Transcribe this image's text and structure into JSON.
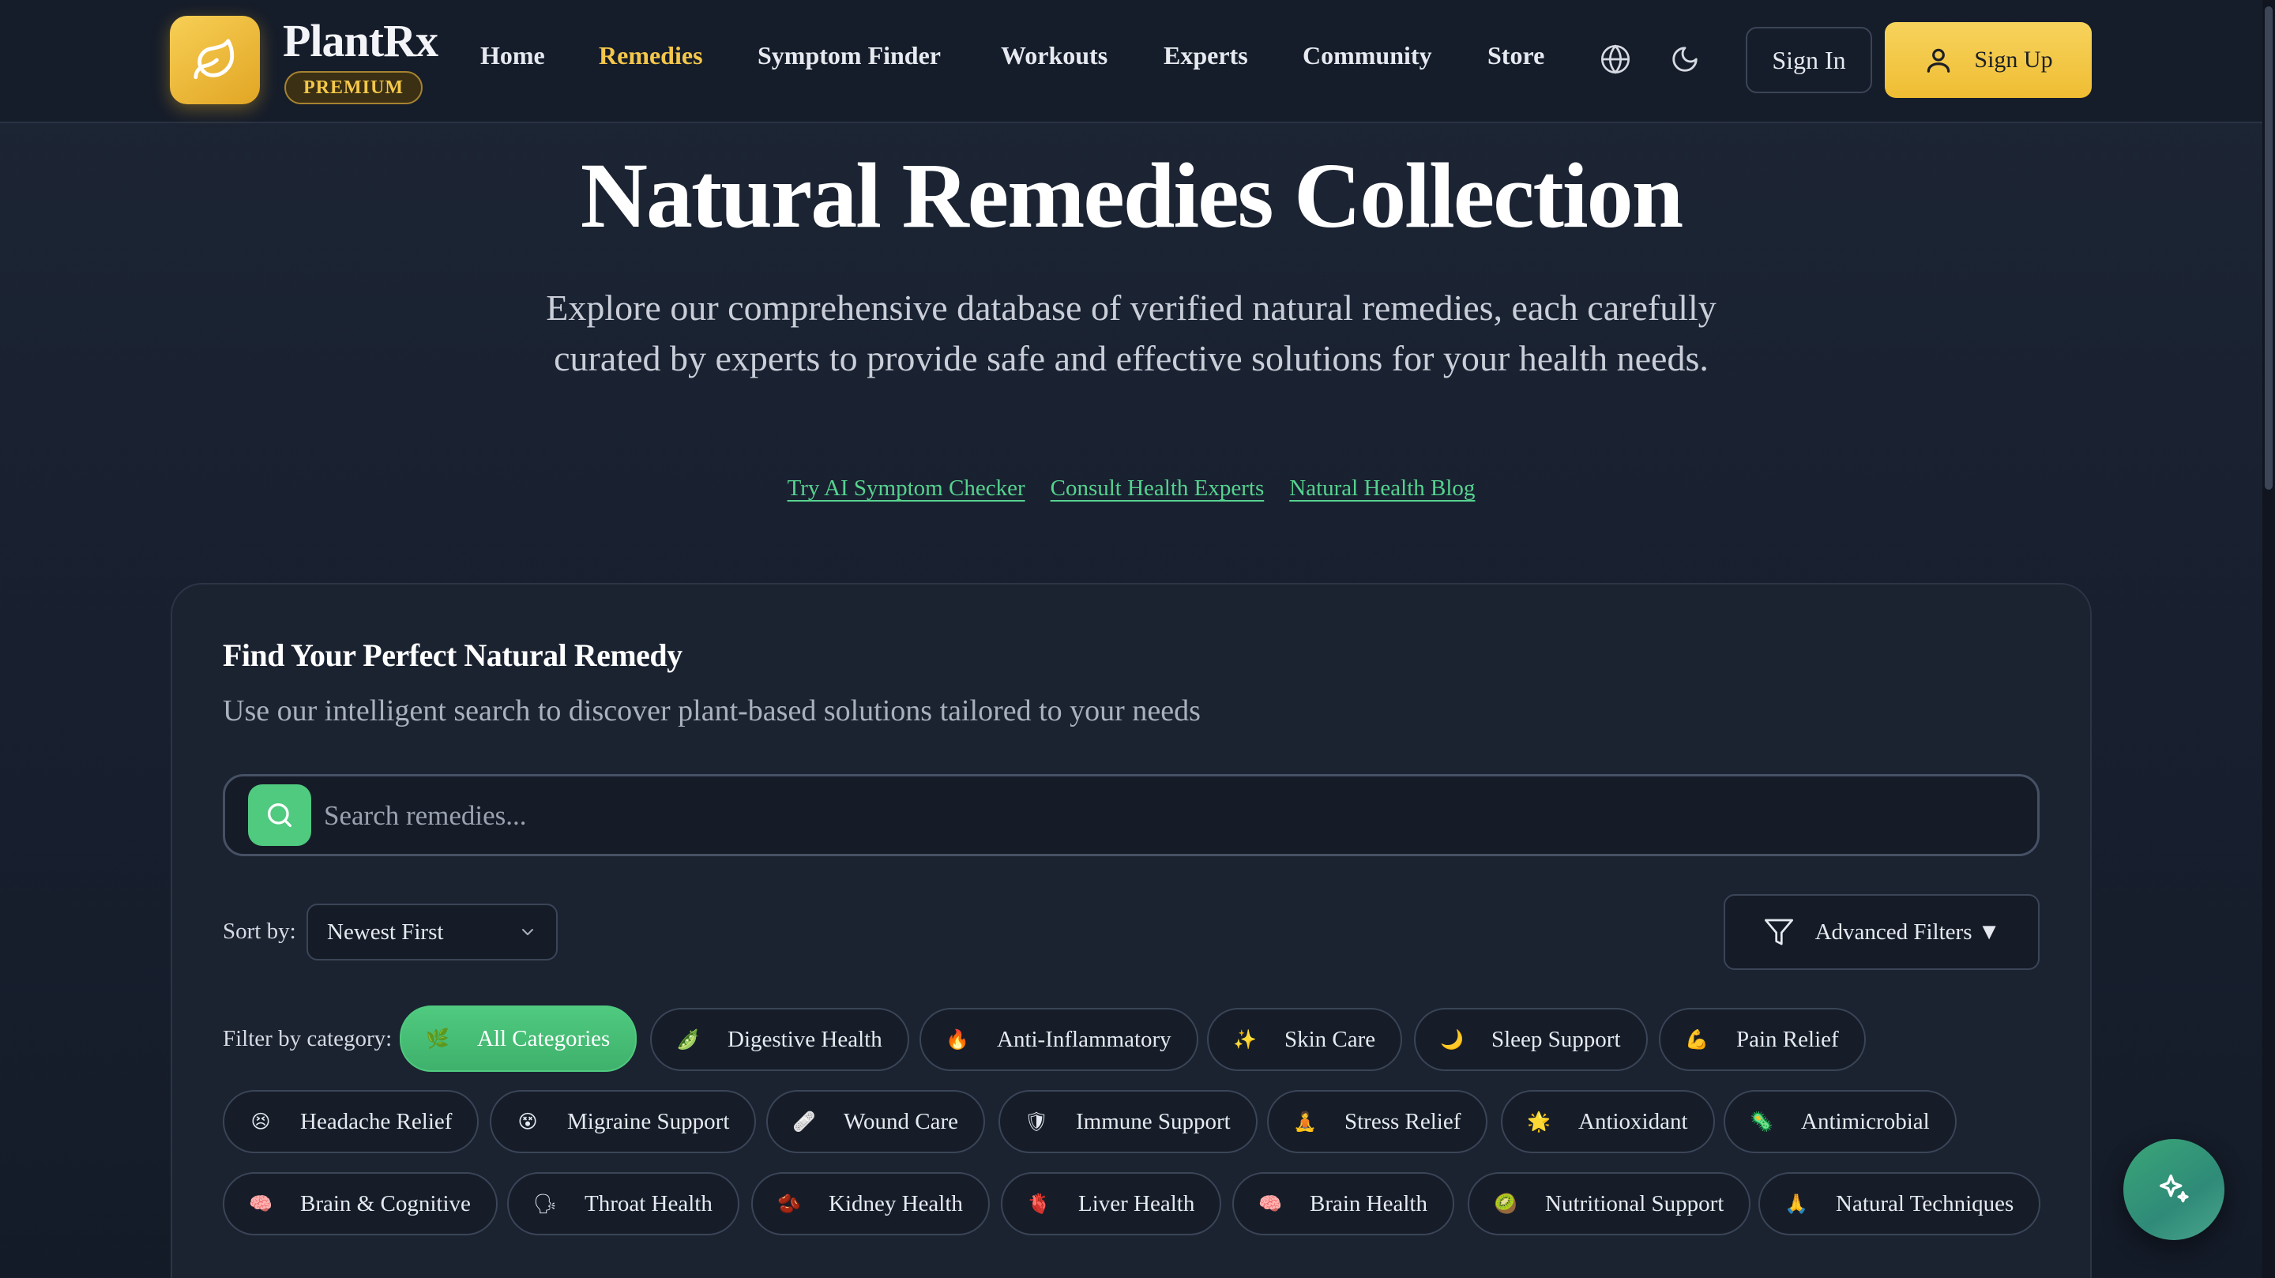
{
  "brand": {
    "name": "PlantRx",
    "badge": "PREMIUM"
  },
  "nav": {
    "links": [
      "Home",
      "Remedies",
      "Symptom Finder",
      "Workouts",
      "Experts",
      "Community",
      "Store"
    ],
    "active": "Remedies",
    "sign_in": "Sign In",
    "sign_up": "Sign Up"
  },
  "hero": {
    "title": "Natural Remedies Collection",
    "subtitle": "Explore our comprehensive database of verified natural remedies, each carefully curated by experts to provide safe and effective solutions for your health needs.",
    "links": [
      "Try AI Symptom Checker",
      "Consult Health Experts",
      "Natural Health Blog"
    ]
  },
  "finder": {
    "title": "Find Your Perfect Natural Remedy",
    "subtitle": "Use our intelligent search to discover plant-based solutions tailored to your needs",
    "search_placeholder": "Search remedies...",
    "sort_label": "Sort by:",
    "sort_value": "Newest First",
    "advanced_filters": "Advanced Filters ▼",
    "filter_label": "Filter by category:",
    "categories": [
      {
        "label": "All Categories",
        "icon": "🌿",
        "active": true
      },
      {
        "label": "Digestive Health",
        "icon": "🫛"
      },
      {
        "label": "Anti-Inflammatory",
        "icon": "🔥"
      },
      {
        "label": "Skin Care",
        "icon": "✨"
      },
      {
        "label": "Sleep Support",
        "icon": "🌙"
      },
      {
        "label": "Pain Relief",
        "icon": "💪"
      },
      {
        "label": "Headache Relief",
        "icon": "😣"
      },
      {
        "label": "Migraine Support",
        "icon": "😵"
      },
      {
        "label": "Wound Care",
        "icon": "🩹"
      },
      {
        "label": "Immune Support",
        "icon": "🛡"
      },
      {
        "label": "Stress Relief",
        "icon": "🧘"
      },
      {
        "label": "Antioxidant",
        "icon": "🌟"
      },
      {
        "label": "Antimicrobial",
        "icon": "🦠"
      },
      {
        "label": "Brain & Cognitive",
        "icon": "🧠"
      },
      {
        "label": "Throat Health",
        "icon": "🗣"
      },
      {
        "label": "Kidney Health",
        "icon": "🫘"
      },
      {
        "label": "Liver Health",
        "icon": "🫀"
      },
      {
        "label": "Brain Health",
        "icon": "🧠"
      },
      {
        "label": "Nutritional Support",
        "icon": "🥝"
      },
      {
        "label": "Natural Techniques",
        "icon": "🙏"
      }
    ]
  },
  "colors": {
    "accent_gold": "#f3c74b",
    "accent_green": "#4fca7f",
    "link_green": "#56d38e",
    "background": "#192131"
  },
  "icons": {
    "logo": "leaf-icon",
    "language": "globe-icon",
    "theme": "moon-icon",
    "user": "user-icon",
    "search": "search-icon",
    "filter": "filter-icon",
    "sort": "chevron-down-icon",
    "assistant": "sparkles-icon"
  }
}
